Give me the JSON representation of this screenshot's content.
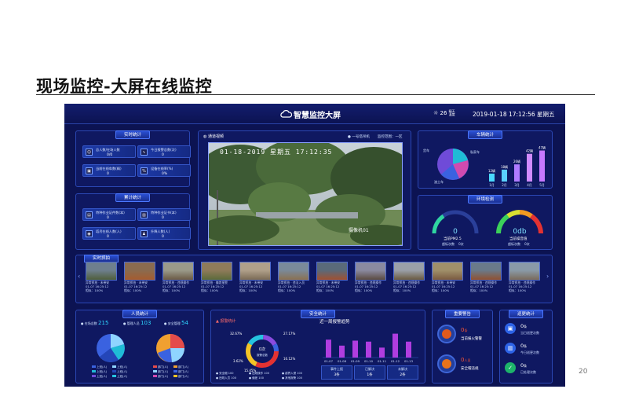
{
  "slide": {
    "title": "现场监控-大屏在线监控",
    "page_number": "20"
  },
  "dashboard": {
    "title": "智慧监控大屏",
    "weather": {
      "temp": "26",
      "unit": "晴天\n温度"
    },
    "datetime": "2019-01-18 17:12:56 星期五",
    "realtime_stats": {
      "title": "实时统计",
      "items": [
        {
          "label": "总人数/在场人数",
          "value": "0/0"
        },
        {
          "label": "今日报警总数(次)",
          "value": "0"
        },
        {
          "label": "当前在线车数(辆)",
          "value": "0"
        },
        {
          "label": "设备在线率(%)",
          "value": "0%"
        }
      ]
    },
    "accum_stats": {
      "title": "累计统计",
      "items": [
        {
          "label": "特种作业证件数(本)",
          "value": "0"
        },
        {
          "label": "特种作业证书(本)",
          "value": "0"
        },
        {
          "label": "塔吊在线人数(人)",
          "value": "0"
        },
        {
          "label": "升降人数(人)",
          "value": "0"
        }
      ]
    },
    "video": {
      "title": "通道视频",
      "camera_name": "一号塔吊机",
      "area": "监控范围：一区",
      "overlay_time": "01-18-2019 星期五 17:12:35",
      "overlay_tag": "摄像机01"
    },
    "vehicles": {
      "title": "车辆统计",
      "bars": [
        {
          "label": "1月",
          "value": 12,
          "text": "12辆"
        },
        {
          "label": "2月",
          "value": 18,
          "text": "18辆"
        },
        {
          "label": "3月",
          "value": 26,
          "text": "26辆"
        },
        {
          "label": "4月",
          "value": 42,
          "text": "42辆"
        },
        {
          "label": "5月",
          "value": 47,
          "text": "47辆"
        }
      ],
      "pie_labels": [
        "货车",
        "私家车",
        "渣土车"
      ]
    },
    "environment": {
      "title": "环境检测",
      "gauge1": {
        "value": "0",
        "label": "当前PM2.5",
        "sub": "超标次数    0次"
      },
      "gauge2": {
        "value": "0db",
        "label": "当前噪音值",
        "sub": "超标次数    0次"
      }
    },
    "realtime_capture": {
      "title": "实时抓拍",
      "cards": [
        {
          "t1": "异常抓拍 · 未带安",
          "t2": "01-07 16:25:12",
          "t3": "相似：100%"
        },
        {
          "t1": "异常抓拍 · 未带安",
          "t2": "01-07 16:25:12",
          "t3": "相似：100%"
        },
        {
          "t1": "异常抓拍 · 违规操作",
          "t2": "01-07 16:25:12",
          "t3": "相似：100%"
        },
        {
          "t1": "异常抓拍 · 偏差报警",
          "t2": "01-07 16:25:12",
          "t3": "相似：100%"
        },
        {
          "t1": "异常抓拍 · 未带安",
          "t2": "01-07 16:25:12",
          "t3": "相似：100%"
        },
        {
          "t1": "异常抓拍 · 违法入员",
          "t2": "01-07 16:25:12",
          "t3": "相似：100%"
        },
        {
          "t1": "异常抓拍 · 未带安",
          "t2": "01-07 16:25:12",
          "t3": "相似：100%"
        },
        {
          "t1": "异常抓拍 · 违规操作",
          "t2": "01-07 16:25:12",
          "t3": "相似：100%"
        },
        {
          "t1": "异常抓拍 · 违规操作",
          "t2": "01-07 16:25:12",
          "t3": "相似：100%"
        },
        {
          "t1": "异常抓拍 · 未带安",
          "t2": "01-07 16:25:12",
          "t3": "相似：100%"
        },
        {
          "t1": "异常抓拍 · 违规操作",
          "t2": "01-07 16:25:12",
          "t3": "相似：100%"
        },
        {
          "t1": "异常抓拍 · 违规操作",
          "t2": "01-07 16:25:12",
          "t3": "相似：100%"
        }
      ]
    },
    "personnel": {
      "title": "人员统计",
      "present": {
        "label": "● 在场总数",
        "value": "215"
      },
      "managers": {
        "label": "● 管理人员",
        "value": "103"
      },
      "security": {
        "label": "● 安全管理",
        "value": "54"
      },
      "legend1": [
        "上班(人)",
        "上班(人)",
        "上班(人)",
        "上班(人)",
        "上班(人)",
        "上班(人)"
      ],
      "legend2": [
        "部门(人)",
        "部门(人)",
        "部门(人)",
        "部门(人)",
        "部门(人)",
        "部门(人)"
      ]
    },
    "alarm_stats": {
      "title": "报警统计",
      "center_value": "0次",
      "center_label": "报警总数",
      "percents": [
        "32.67%",
        "27.17%",
        "3.62%",
        "16.12%",
        "15.45%"
      ],
      "legend": [
        "● 安全帽 100",
        "● 违规操作 100",
        "● 越界入侵 100",
        "● 违规入员 100",
        "● 偏差 100",
        "● 其他报警 100"
      ]
    },
    "safety": {
      "title": "安全统计",
      "chart_title": "近一周报警趋势",
      "bars": [
        {
          "label": "01-07",
          "value": 18
        },
        {
          "label": "01-08",
          "value": 12
        },
        {
          "label": "01-09",
          "value": 17
        },
        {
          "label": "01-10",
          "value": 16
        },
        {
          "label": "01-11",
          "value": 10
        },
        {
          "label": "01-12",
          "value": 24
        },
        {
          "label": "01-13",
          "value": 16
        }
      ],
      "summary": [
        {
          "label": "事件上报",
          "value": "3条"
        },
        {
          "label": "已解决",
          "value": "1条"
        },
        {
          "label": "未解决",
          "value": "2条"
        }
      ]
    },
    "warnings": {
      "title": "重要警告",
      "items": [
        {
          "value": "0",
          "unit": "条",
          "label": "当前报火警警"
        },
        {
          "value": "0",
          "unit": "人员",
          "label": "安全帽违规"
        }
      ]
    },
    "inspection": {
      "title": "巡更统计",
      "items": [
        {
          "value": "0",
          "unit": "条",
          "label": "当日巡更次数"
        },
        {
          "value": "0",
          "unit": "条",
          "label": "今日巡更次数"
        },
        {
          "value": "0",
          "unit": "条",
          "label": "已处理次数"
        }
      ]
    }
  },
  "colors": {
    "bg": "#0c1352",
    "panel_border": "#2b47b4",
    "accent": "#4c78ff"
  }
}
